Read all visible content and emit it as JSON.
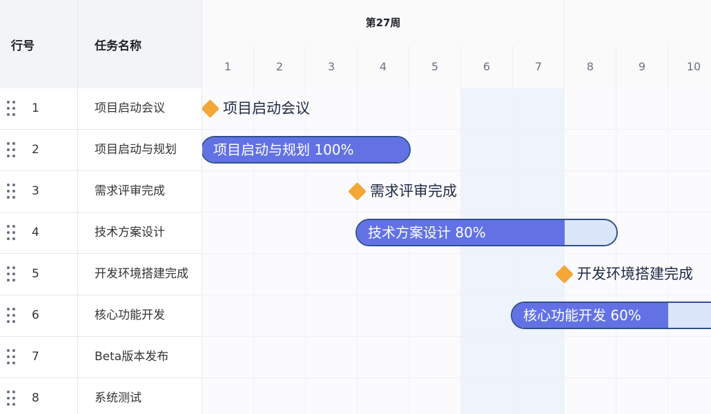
{
  "header": {
    "row_no_label": "行号",
    "task_name_label": "任务名称"
  },
  "timeline": {
    "week_label": "第27周",
    "days": [
      "1",
      "2",
      "3",
      "4",
      "5",
      "6",
      "7",
      "8",
      "9",
      "10"
    ],
    "weekend_days": [
      "6",
      "7"
    ]
  },
  "tasks": [
    {
      "no": "1",
      "name": "项目启动会议"
    },
    {
      "no": "2",
      "name": "项目启动与规划"
    },
    {
      "no": "3",
      "name": "需求评审完成"
    },
    {
      "no": "4",
      "name": "技术方案设计"
    },
    {
      "no": "5",
      "name": "开发环境搭建完成"
    },
    {
      "no": "6",
      "name": "核心功能开发"
    },
    {
      "no": "7",
      "name": "Beta版本发布"
    },
    {
      "no": "8",
      "name": "系统测试"
    }
  ],
  "gantt": {
    "milestones": [
      {
        "label": "项目启动会议"
      },
      {
        "label": "需求评审完成"
      },
      {
        "label": "开发环境搭建完成"
      }
    ],
    "bars": [
      {
        "label": "项目启动与规划 100%",
        "progress": 1.0
      },
      {
        "label": "技术方案设计 80%",
        "progress": 0.8
      },
      {
        "label": "核心功能开发 60%",
        "progress": 0.6
      }
    ]
  },
  "colors": {
    "milestone": "#f4a636",
    "bar_fill": "#6272e5",
    "bar_border": "#2f4f8c",
    "bar_remaining": "#dbe6fb",
    "weekend_bg": "#eef3fc"
  }
}
